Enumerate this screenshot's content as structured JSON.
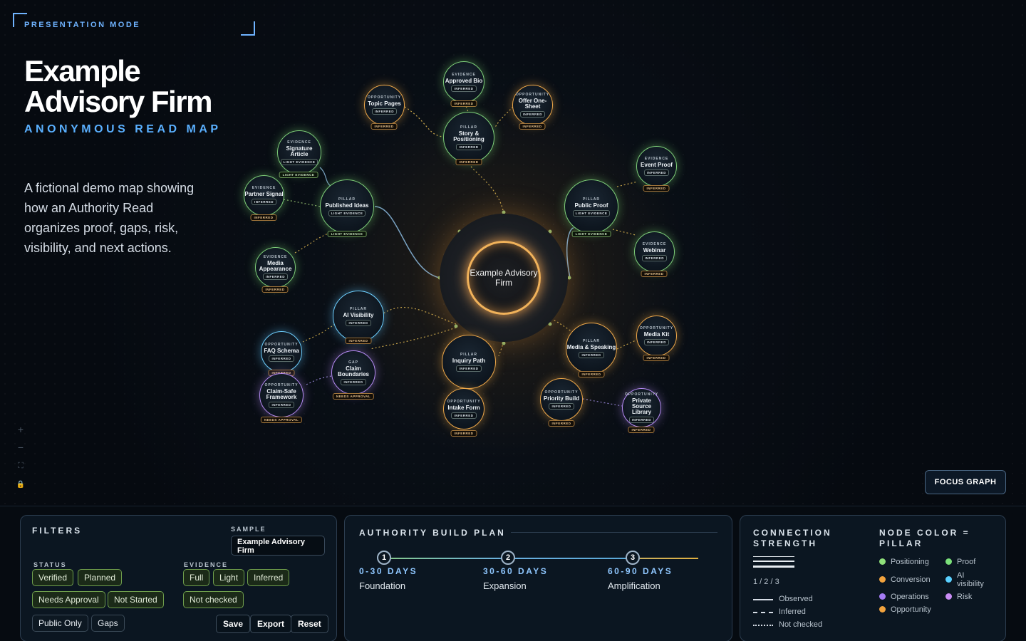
{
  "header": {
    "mode_label": "PRESENTATION MODE",
    "title": "Example Advisory Firm",
    "subtitle": "ANONYMOUS READ MAP",
    "description": "A fictional demo map showing how an Authority Read organizes proof, gaps, risk, visibility, and next actions."
  },
  "graph": {
    "center_label": "Example Advisory Firm",
    "nodes": {
      "approved_bio": {
        "kind": "EVIDENCE",
        "label": "Approved Bio",
        "badge": "INFERRED",
        "tag": "INFERRED"
      },
      "topic_pages": {
        "kind": "OPPORTUNITY",
        "label": "Topic Pages",
        "badge": "INFERRED",
        "tag": "INFERRED"
      },
      "offer_sheet": {
        "kind": "OPPORTUNITY",
        "label": "Offer One-Sheet",
        "badge": "INFERRED",
        "tag": "INFERRED"
      },
      "story": {
        "kind": "PILLAR",
        "label": "Story & Positioning",
        "badge": "INFERRED",
        "tag": "INFERRED"
      },
      "signature_article": {
        "kind": "EVIDENCE",
        "label": "Signature Article",
        "badge": "LIGHT EVIDENCE",
        "tag": "LIGHT EVIDENCE"
      },
      "event_proof": {
        "kind": "EVIDENCE",
        "label": "Event Proof",
        "badge": "INFERRED",
        "tag": "INFERRED"
      },
      "partner_signal": {
        "kind": "EVIDENCE",
        "label": "Partner Signal",
        "badge": "INFERRED",
        "tag": "INFERRED"
      },
      "published_ideas": {
        "kind": "PILLAR",
        "label": "Published Ideas",
        "badge": "LIGHT EVIDENCE",
        "tag": "LIGHT EVIDENCE"
      },
      "public_proof": {
        "kind": "PILLAR",
        "label": "Public Proof",
        "badge": "LIGHT EVIDENCE",
        "tag": "LIGHT EVIDENCE"
      },
      "webinar": {
        "kind": "EVIDENCE",
        "label": "Webinar",
        "badge": "INFERRED",
        "tag": "INFERRED"
      },
      "media_appearance": {
        "kind": "EVIDENCE",
        "label": "Media Appearance",
        "badge": "INFERRED",
        "tag": "INFERRED"
      },
      "ai_visibility": {
        "kind": "PILLAR",
        "label": "AI Visibility",
        "badge": "INFERRED",
        "tag": "INFERRED"
      },
      "faq_schema": {
        "kind": "OPPORTUNITY",
        "label": "FAQ Schema",
        "badge": "INFERRED",
        "tag": "INFERRED"
      },
      "media_kit": {
        "kind": "OPPORTUNITY",
        "label": "Media Kit",
        "badge": "INFERRED",
        "tag": "INFERRED"
      },
      "media_speaking": {
        "kind": "PILLAR",
        "label": "Media & Speaking",
        "badge": "INFERRED",
        "tag": "INFERRED"
      },
      "inquiry_path": {
        "kind": "PILLAR",
        "label": "Inquiry Path",
        "badge": "INFERRED",
        "tag": ""
      },
      "claim_boundaries": {
        "kind": "GAP",
        "label": "Claim Boundaries",
        "badge": "INFERRED",
        "tag": "NEEDS APPROVAL"
      },
      "claim_safe": {
        "kind": "OPPORTUNITY",
        "label": "Claim-Safe Framework",
        "badge": "INFERRED",
        "tag": "NEEDS APPROVAL"
      },
      "intake_form": {
        "kind": "OPPORTUNITY",
        "label": "Intake Form",
        "badge": "INFERRED",
        "tag": "INFERRED"
      },
      "priority_build": {
        "kind": "OPPORTUNITY",
        "label": "Priority Build",
        "badge": "INFERRED",
        "tag": "INFERRED"
      },
      "private_source": {
        "kind": "OPPORTUNITY",
        "label": "Private Source Library",
        "badge": "INFERRED",
        "tag": "INFERRED"
      }
    },
    "controls": {
      "zoom_in": "+",
      "zoom_out": "−",
      "fit": "⛶",
      "lock": "🔒"
    },
    "focus_button": "FOCUS GRAPH"
  },
  "filters": {
    "title": "FILTERS",
    "sample_label": "SAMPLE",
    "sample_value": "Example Advisory Firm",
    "status_label": "STATUS",
    "status_chips": [
      "Verified",
      "Planned",
      "Needs Approval",
      "Not Started"
    ],
    "evidence_label": "EVIDENCE",
    "evidence_chips": [
      "Full",
      "Light",
      "Inferred",
      "Not checked"
    ],
    "extra_chips": [
      "Public Only",
      "Gaps"
    ],
    "buttons": [
      "Save",
      "Export",
      "Reset"
    ]
  },
  "plan": {
    "title": "AUTHORITY BUILD PLAN",
    "steps": [
      {
        "num": "1",
        "range": "0-30 DAYS",
        "phase": "Foundation"
      },
      {
        "num": "2",
        "range": "30-60 DAYS",
        "phase": "Expansion"
      },
      {
        "num": "3",
        "range": "60-90 DAYS",
        "phase": "Amplification"
      }
    ]
  },
  "legend": {
    "strength_title": "CONNECTION STRENGTH",
    "strength_scale": "1 / 2 / 3",
    "line_types": [
      "Observed",
      "Inferred",
      "Not checked"
    ],
    "pillar_title": "NODE COLOR = PILLAR",
    "pillars": [
      {
        "label": "Positioning",
        "color": "#8fe07a"
      },
      {
        "label": "Proof",
        "color": "#7be07a"
      },
      {
        "label": "Conversion",
        "color": "#f2a33e"
      },
      {
        "label": "AI visibility",
        "color": "#5ad0ff"
      },
      {
        "label": "Operations",
        "color": "#a57cf5"
      },
      {
        "label": "Risk",
        "color": "#c98cf5"
      },
      {
        "label": "Opportunity",
        "color": "#f2a33e"
      }
    ]
  }
}
